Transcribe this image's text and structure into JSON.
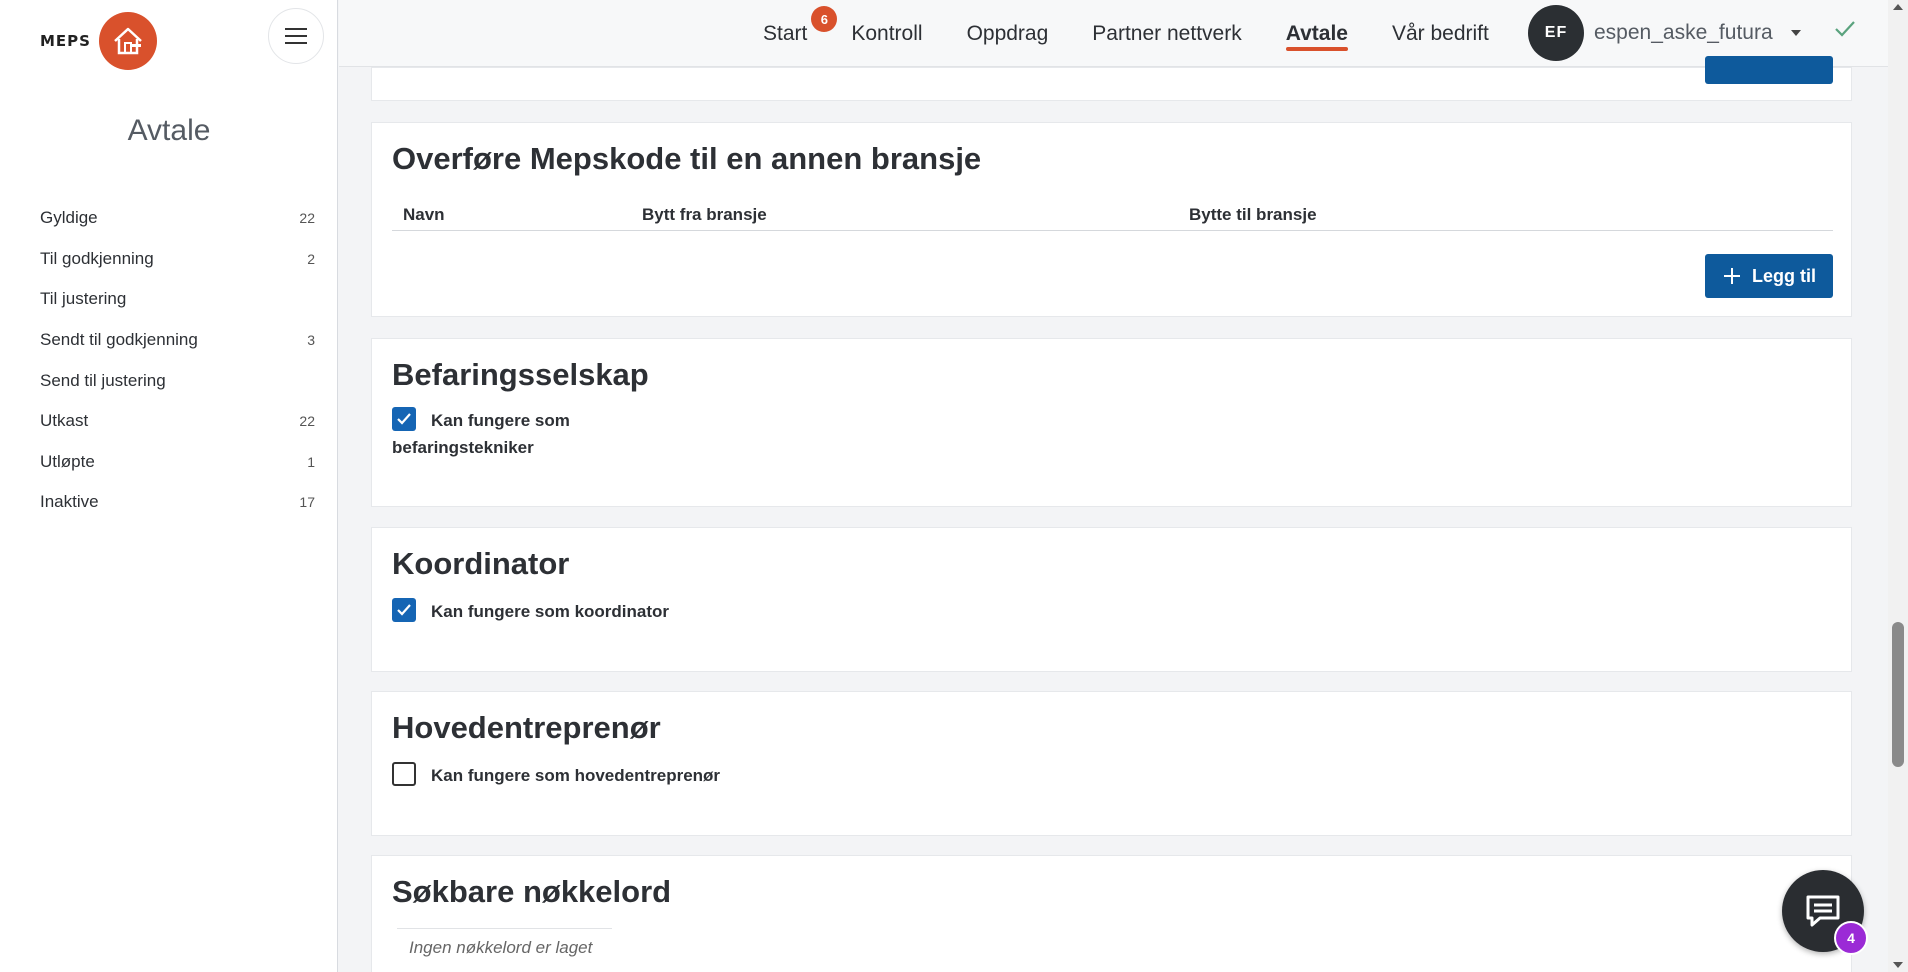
{
  "logo": {
    "text": "MEPS"
  },
  "sidebar": {
    "title": "Avtale",
    "items": [
      {
        "label": "Gyldige",
        "count": "22"
      },
      {
        "label": "Til godkjenning",
        "count": "2"
      },
      {
        "label": "Til justering",
        "count": ""
      },
      {
        "label": "Sendt til godkjenning",
        "count": "3"
      },
      {
        "label": "Send til justering",
        "count": ""
      },
      {
        "label": "Utkast",
        "count": "22"
      },
      {
        "label": "Utløpte",
        "count": "1"
      },
      {
        "label": "Inaktive",
        "count": "17"
      }
    ]
  },
  "nav": {
    "items": [
      {
        "label": "Start",
        "badge": "6",
        "active": false
      },
      {
        "label": "Kontroll",
        "active": false
      },
      {
        "label": "Oppdrag",
        "active": false
      },
      {
        "label": "Partner nettverk",
        "active": false
      },
      {
        "label": "Avtale",
        "active": true
      },
      {
        "label": "Vår bedrift",
        "active": false
      }
    ],
    "user": {
      "initials": "EF",
      "name": "espen_aske_futura"
    }
  },
  "sections": {
    "transfer": {
      "title": "Overføre Mepskode til en annen bransje",
      "columns": [
        "Navn",
        "Bytt fra bransje",
        "Bytte til bransje"
      ],
      "add_label": "Legg til"
    },
    "inspection": {
      "title": "Befaringsselskap",
      "checkbox_label_1": "Kan fungere som",
      "checkbox_label_2": "befaringstekniker",
      "checked": true
    },
    "coordinator": {
      "title": "Koordinator",
      "checkbox_label": "Kan fungere som koordinator",
      "checked": true
    },
    "contractor": {
      "title": "Hovedentreprenør",
      "checkbox_label": "Kan fungere som hovedentreprenør",
      "checked": false
    },
    "keywords": {
      "title": "Søkbare nøkkelord",
      "empty_text": "Ingen nøkkelord er laget"
    }
  },
  "chat": {
    "badge": "4"
  },
  "colors": {
    "accent": "#d9512c",
    "primary": "#0e5a9c",
    "checkbox": "#1565b4",
    "chat_badge": "#9b2ad6"
  }
}
